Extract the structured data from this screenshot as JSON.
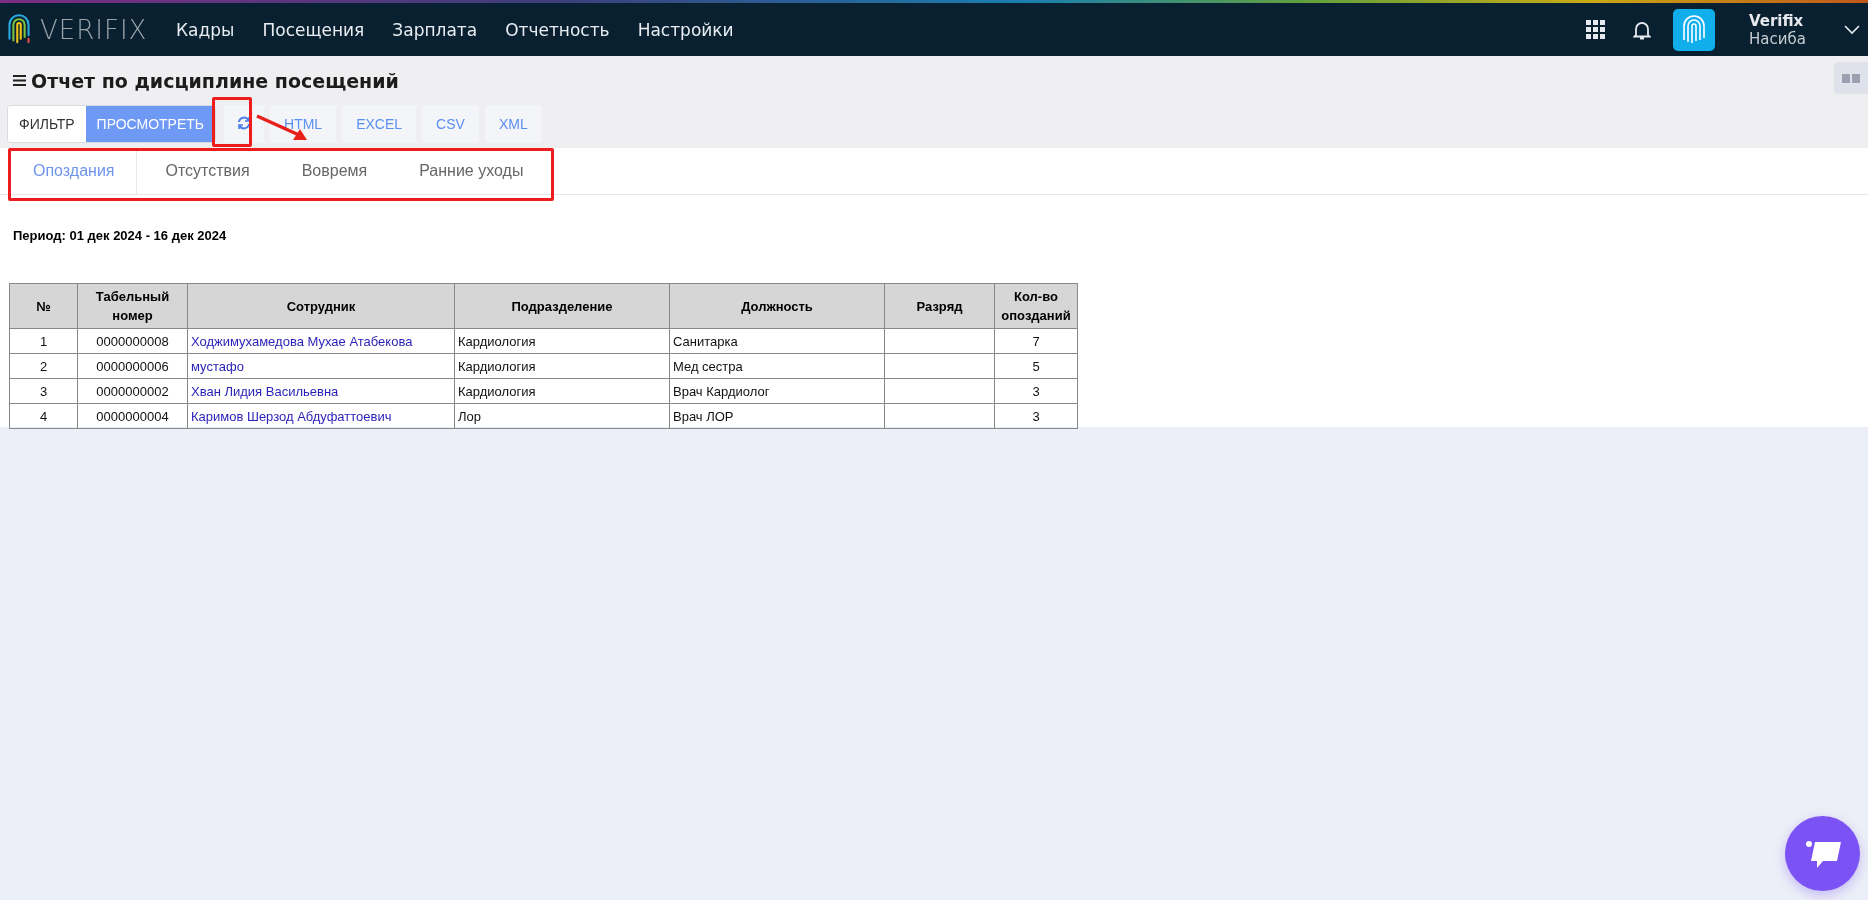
{
  "brand": {
    "name": "VERIFIX"
  },
  "nav": [
    "Кадры",
    "Посещения",
    "Зарплата",
    "Отчетность",
    "Настройки"
  ],
  "user": {
    "company": "Verifix",
    "name": "Насиба"
  },
  "page": {
    "title": "Отчет по дисциплине посещений"
  },
  "mode_buttons": [
    {
      "label": "ФИЛЬТР",
      "selected": false
    },
    {
      "label": "ПРОСМОТРЕТЬ",
      "selected": true
    }
  ],
  "export_buttons": [
    "HTML",
    "EXCEL",
    "CSV",
    "XML"
  ],
  "tabs": [
    {
      "label": "Опоздания",
      "selected": true
    },
    {
      "label": "Отсутствия",
      "selected": false
    },
    {
      "label": "Вовремя",
      "selected": false
    },
    {
      "label": "Ранние уходы",
      "selected": false
    }
  ],
  "report": {
    "period": "Период: 01 дек 2024 - 16 дек 2024",
    "columns": [
      "№",
      "Табельный номер",
      "Сотрудник",
      "Подразделение",
      "Должность",
      "Разряд",
      "Кол-во опозданий"
    ],
    "rows": [
      [
        "1",
        "0000000008",
        "Ходжимухамедова Мухае Атабекова",
        "Кардиология",
        "Санитарка",
        "",
        "7"
      ],
      [
        "2",
        "0000000006",
        "мустафо",
        "Кардиология",
        "Мед сестра",
        "",
        "5"
      ],
      [
        "3",
        "0000000002",
        "Хван Лидия Васильевна",
        "Кардиология",
        "Врач Кардиолог",
        "",
        "3"
      ],
      [
        "4",
        "0000000004",
        "Каримов Шерзод Абдуфаттоевич",
        "Лор",
        "Врач ЛОР",
        "",
        "3"
      ]
    ]
  }
}
